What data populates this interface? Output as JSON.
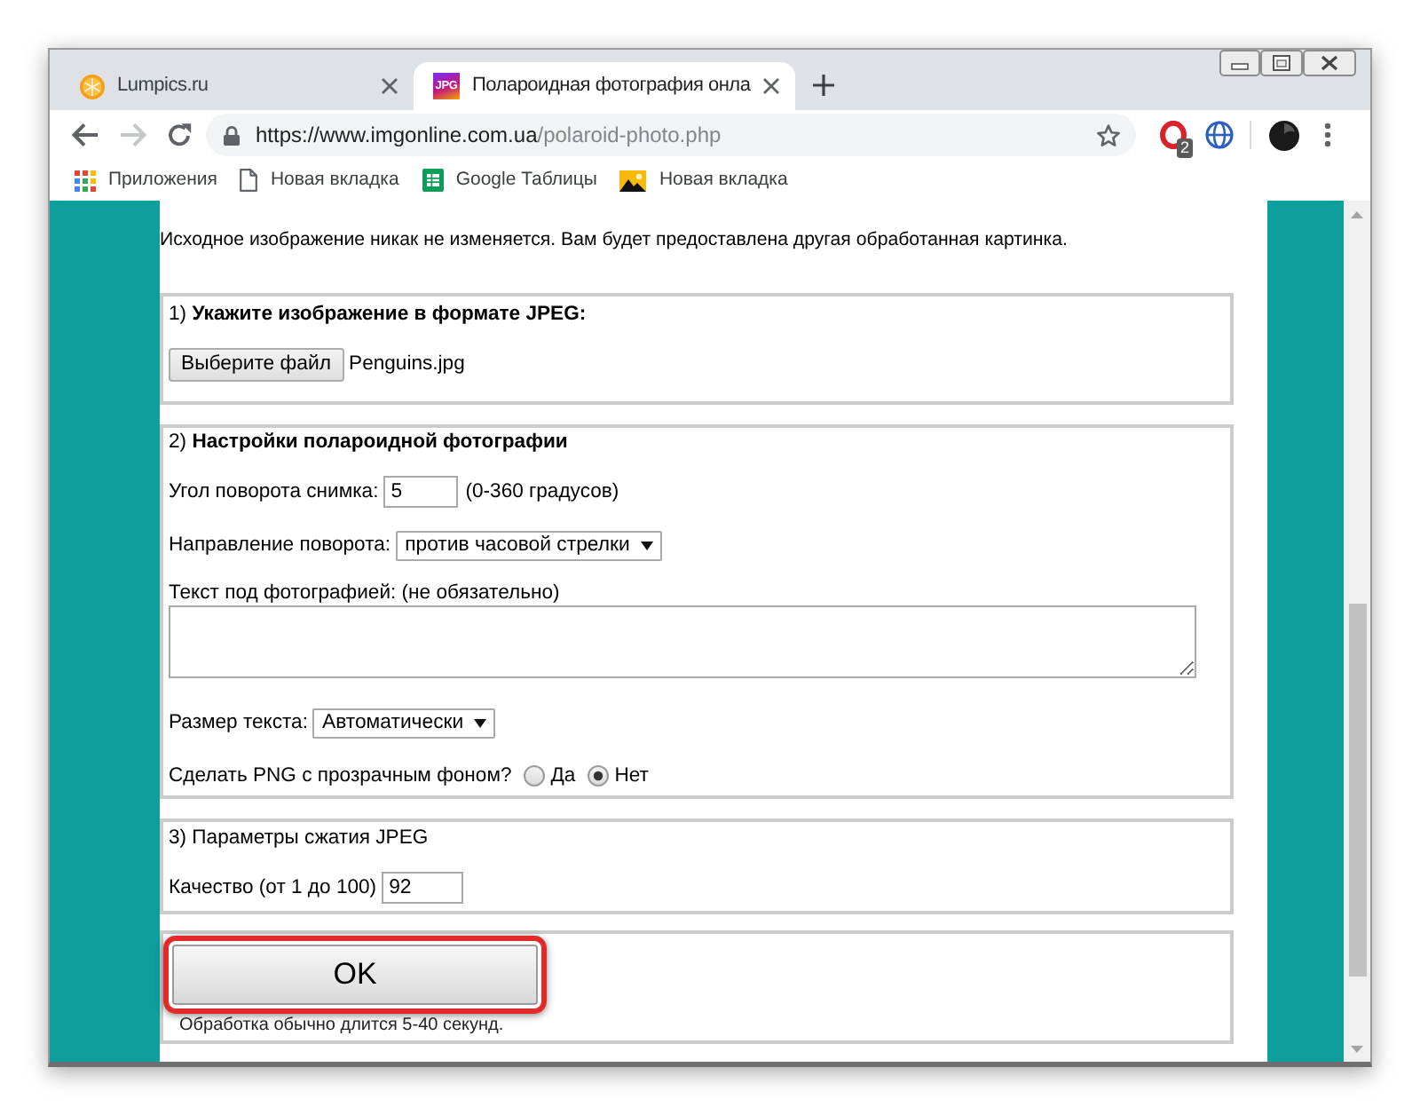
{
  "tabs": [
    {
      "title": "Lumpics.ru",
      "kind": "circle",
      "selected": false
    },
    {
      "title": "Полароидная фотография онла",
      "kind": "tile",
      "favicon_text": "JPG",
      "selected": true
    }
  ],
  "toolbar": {
    "nav": [
      {
        "kind": "back",
        "disabled": false
      },
      {
        "kind": "forward",
        "disabled": true
      },
      {
        "kind": "reload",
        "disabled": false
      }
    ],
    "url_host": "https://www.imgonline.com.ua",
    "url_path": "/polaroid-photo.php",
    "extension_badge": "2"
  },
  "bookmarks": [
    {
      "label": "Приложения",
      "kind": "apps"
    },
    {
      "label": "Новая вкладка",
      "kind": "page"
    },
    {
      "label": "Google Таблицы",
      "kind": "sheet"
    },
    {
      "label": "Новая вкладка",
      "kind": "image"
    }
  ],
  "page": {
    "intro": "Исходное изображение никак не изменяется. Вам будет предоставлена другая обработанная картинка.",
    "sections": [
      {
        "title": "1) **Укажите изображение в формате JPEG:**",
        "fields": [
          {
            "kind": "file",
            "button": "Выберите файл",
            "value": "Penguins.jpg"
          }
        ]
      },
      {
        "title": "2) **Настройки полароидной фотографии**",
        "fields": [
          {
            "kind": "text",
            "label": "Угол поворота снимка:",
            "value": "5",
            "hint": "(0-360 градусов)"
          },
          {
            "kind": "select",
            "label": "Направление поворота:",
            "value": "против часовой стрелки"
          },
          {
            "kind": "textarea",
            "label": "Текст под фотографией: (не обязательно)"
          },
          {
            "kind": "select",
            "label": "Размер текста:",
            "value": "Автоматически"
          },
          {
            "kind": "radio",
            "label": "Сделать PNG с прозрачным фоном?",
            "options": [
              {
                "label": "Да",
                "selected": false
              },
              {
                "label": "Нет",
                "selected": true
              }
            ]
          }
        ]
      },
      {
        "title": "3) Параметры сжатия JPEG",
        "fields": [
          {
            "kind": "text",
            "label": "Качество (от 1 до 100)",
            "value": "92"
          }
        ]
      },
      {
        "fields": [
          {
            "kind": "submit",
            "label": "OK",
            "highlighted": true
          },
          {
            "kind": "note",
            "text": "Обработка обычно длится 5-40 секунд."
          }
        ]
      }
    ]
  }
}
